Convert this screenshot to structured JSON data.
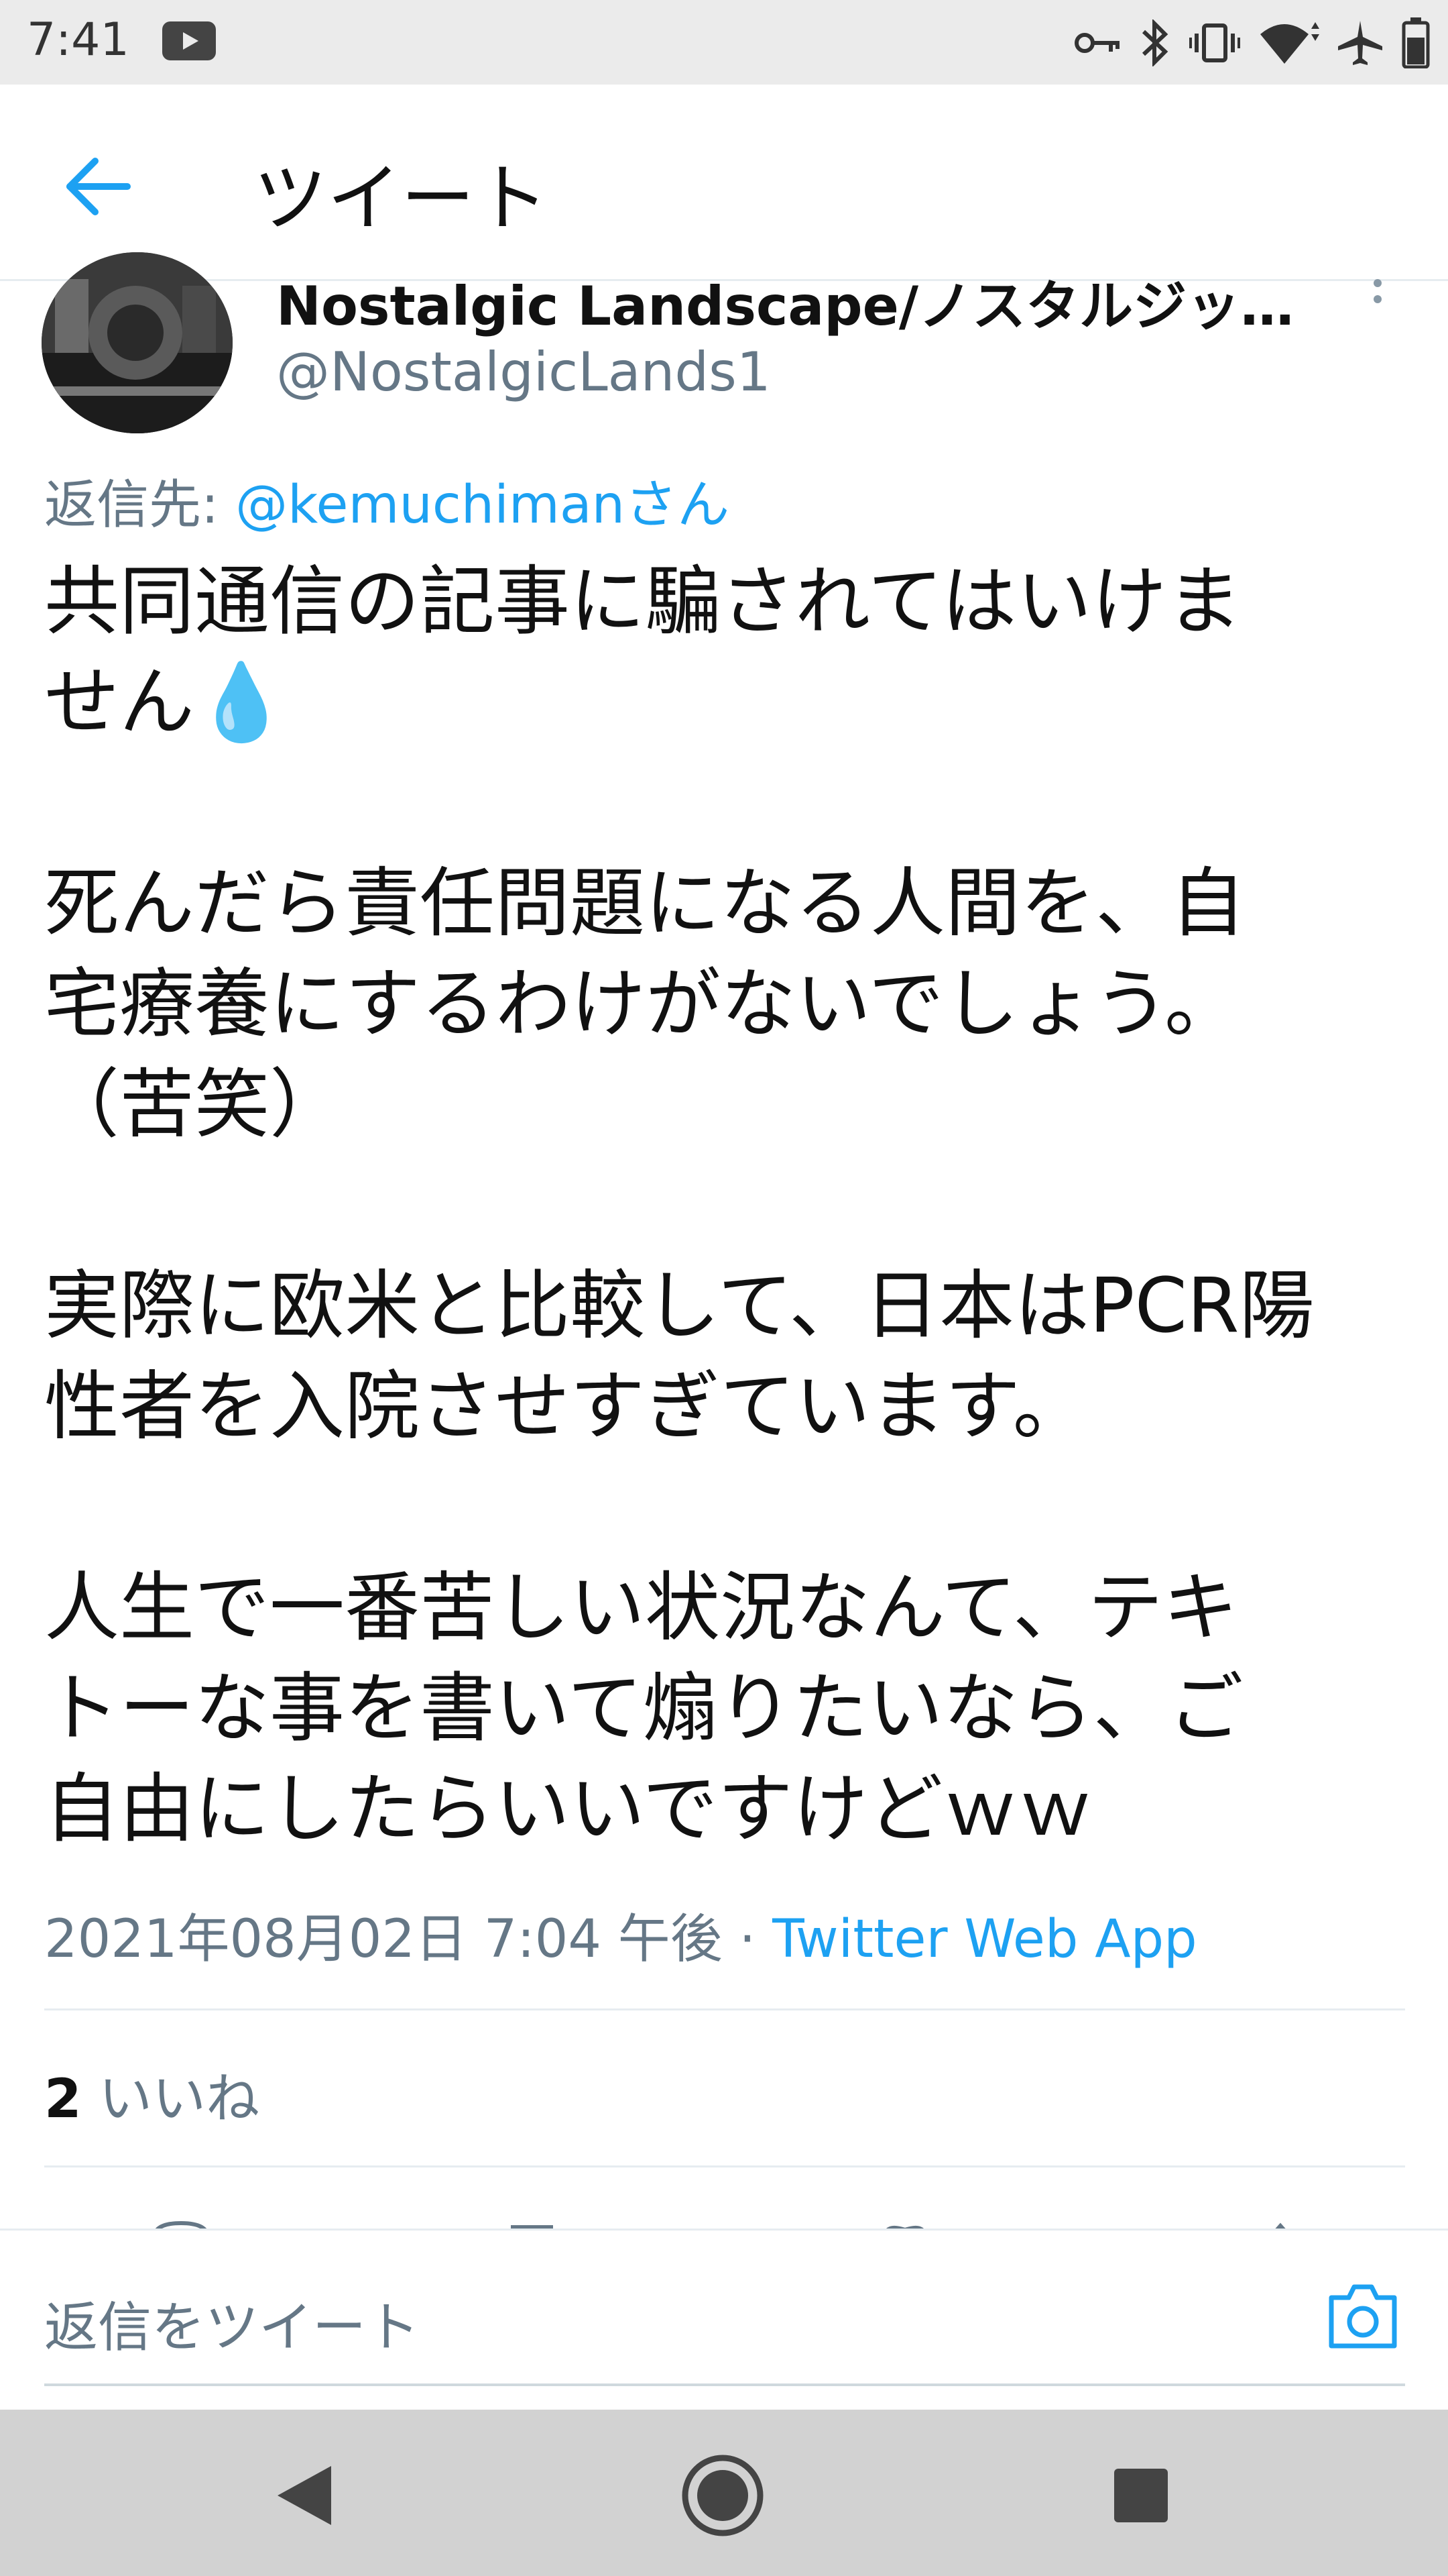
{
  "status_bar": {
    "time": "7:41",
    "icons": [
      "youtube-icon",
      "key-icon",
      "bluetooth-icon",
      "vibrate-icon",
      "wifi-icon",
      "airplane-icon",
      "battery-icon"
    ]
  },
  "app_bar": {
    "title": "ツイート",
    "back_icon": "arrow-left-icon"
  },
  "author": {
    "display_name": "Nostalgic Landscape/ノスタルジック …",
    "handle": "@NostalgicLands1"
  },
  "reply_to": {
    "prefix": "返信先: ",
    "mention": "@kemuchimanさん"
  },
  "tweet": {
    "text": "共同通信の記事に騙されてはいけま\nせん💧\n\n死んだら責任問題になる人間を、自\n宅療養にするわけがないでしょう。\n（苦笑）\n\n実際に欧米と比較して、日本はPCR陽\n性者を入院させすぎています。\n\n人生で一番苦しい状況なんて、テキ\nトーな事を書いて煽りたいなら、ご\n自由にしたらいいですけどｗｗ",
    "timestamp": "2021年08月02日 7:04 午後 · ",
    "source": "Twitter Web App"
  },
  "engagement": {
    "like_count": "2",
    "like_label": " いいね"
  },
  "composer": {
    "placeholder": "返信をツイート",
    "camera_icon": "camera-icon"
  },
  "nav_bar": {
    "icons": [
      "nav-back-icon",
      "nav-home-icon",
      "nav-recents-icon"
    ]
  },
  "colors": {
    "accent": "#1da1f2",
    "secondary_text": "#657786",
    "status_bar_bg": "#ebebeb",
    "nav_bar_bg": "#d2d2d2"
  }
}
